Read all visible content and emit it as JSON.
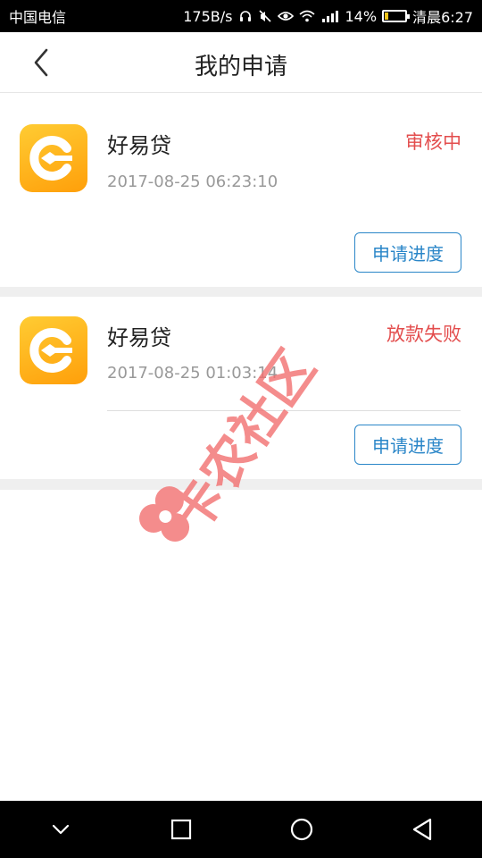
{
  "status_bar": {
    "carrier": "中国电信",
    "network_speed": "175B/s",
    "battery_percent": "14%",
    "time": "清晨6:27",
    "icons": [
      "headset-icon",
      "mute-icon",
      "eye-icon",
      "wifi-icon",
      "signal-icon",
      "battery-icon"
    ]
  },
  "header": {
    "title": "我的申请",
    "back_icon": "chevron-left-icon"
  },
  "applications": [
    {
      "app_name": "好易贷",
      "timestamp": "2017-08-25 06:23:10",
      "status": "审核中",
      "button_label": "申请进度"
    },
    {
      "app_name": "好易贷",
      "timestamp": "2017-08-25 01:03:14",
      "status": "放款失败",
      "button_label": "申请进度"
    }
  ],
  "watermark": {
    "text": "卡农社区"
  },
  "colors": {
    "status_red": "#e34d4d",
    "accent_blue": "#2a86c8",
    "logo_orange": "#ff9f0a",
    "watermark_red": "#f26d6d"
  },
  "nav_bar": {
    "icons": [
      "chevron-down-icon",
      "square-icon",
      "circle-icon",
      "triangle-back-icon"
    ]
  }
}
